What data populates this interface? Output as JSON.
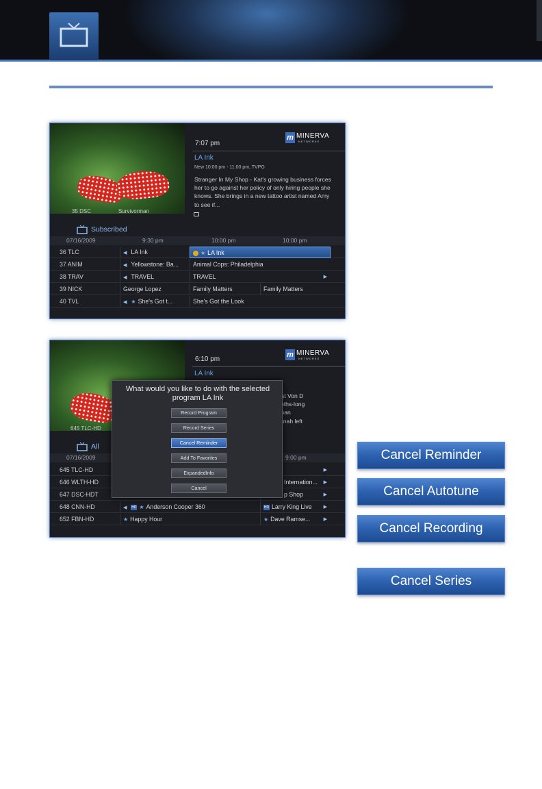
{
  "colors": {
    "accent": "#4b79b6",
    "header_dark": "#0d0f14",
    "button_blue": "#2f64b2"
  },
  "icons": {
    "header": "tv-icon",
    "guide": "tv-icon"
  },
  "screen1": {
    "logo": {
      "mark": "m",
      "word": "MINERVA",
      "sub": "NETWORKS"
    },
    "photo_caption": {
      "channel": "35  DSC",
      "program": "Survivorman"
    },
    "time": "7:07 pm",
    "program_title": "LA Ink",
    "program_meta": "New 10:00 pm - 11:00 pm, TVPG",
    "program_desc": "Stranger In My Shop - Kat's growing business forces her to go against her policy of only hiring people she knows. She brings in a new tattoo artist named Amy to see if...",
    "guide_label": "Subscribed",
    "grid_head": {
      "date": "07/16/2009",
      "t1": "9:30 pm",
      "t2": "10:00 pm",
      "t3": "10:00 pm"
    },
    "rows": [
      {
        "channel": "36  TLC",
        "c1": "LA Ink",
        "c2": "LA Ink"
      },
      {
        "channel": "37  ANIM",
        "c1": "Yellowstone: Ba...",
        "c2": "Animal Cops: Philadelphia"
      },
      {
        "channel": "38  TRAV",
        "c1": "TRAVEL",
        "c2": "TRAVEL"
      },
      {
        "channel": "39  NICK",
        "c1": "George Lopez",
        "c2": "Family Matters",
        "c3": "Family Matters"
      },
      {
        "channel": "40  TVL",
        "c1": "She's Got t...",
        "c2": "She's Got the Look"
      }
    ]
  },
  "screen2": {
    "logo": {
      "mark": "m",
      "word": "MINERVA",
      "sub": "NETWORKS"
    },
    "photo_caption": {
      "channel": "645  TLC-HD"
    },
    "time": "6:10 pm",
    "program_title": "LA Ink",
    "desc_fragments": [
      "s Kat Von D",
      "months-long",
      "er than",
      "Hannah left"
    ],
    "guide_label": "All",
    "grid_head": {
      "date": "07/16/2009",
      "t3": "9:00 pm"
    },
    "rows": [
      {
        "channel": "645  TLC-HD"
      },
      {
        "channel": "646  WLTH-HD",
        "right": "Internation..."
      },
      {
        "channel": "647  DSC-HDT",
        "right": "p Shop"
      },
      {
        "channel": "648  CNN-HD",
        "c1": "Anderson Cooper 360",
        "right": "Larry King Live"
      },
      {
        "channel": "652  FBN-HD",
        "c1": "Happy Hour",
        "right": "Dave Ramse..."
      }
    ],
    "dialog": {
      "title_line1": "What would you like to do with the selected",
      "title_line2": "program LA Ink",
      "buttons": [
        "Record Program",
        "Record Series",
        "Cancel Reminder",
        "Add To Favorites",
        "ExpandedInfo",
        "Cancel"
      ]
    }
  },
  "side_buttons": [
    "Cancel Reminder",
    "Cancel Autotune",
    "Cancel Recording",
    "Cancel Series"
  ]
}
